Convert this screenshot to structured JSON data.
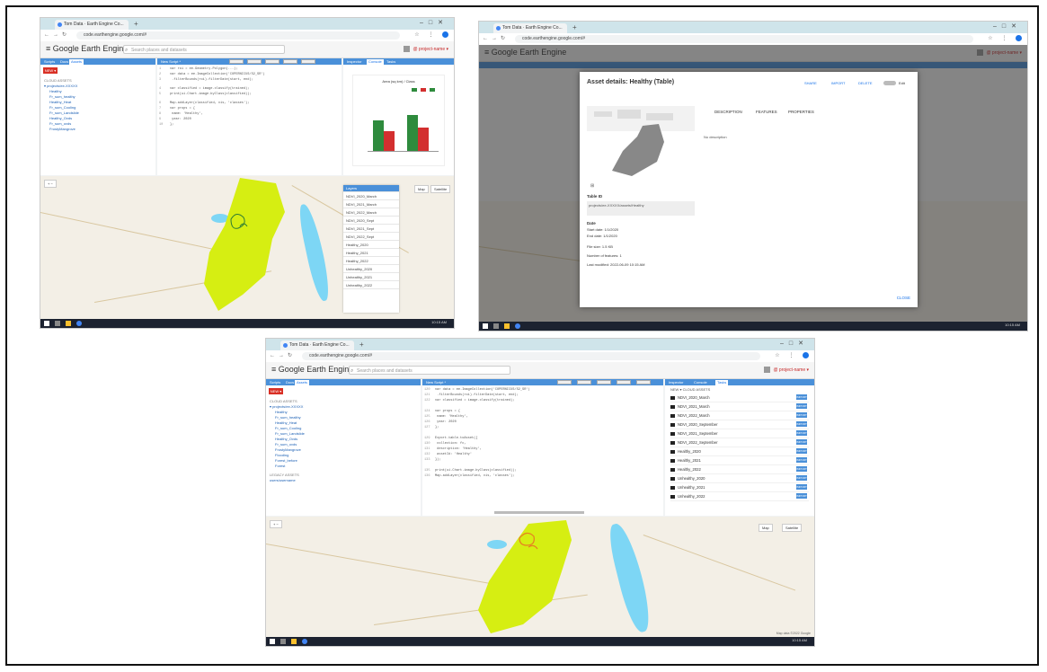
{
  "browser": {
    "tab_title": "Tom Data · Earth Engine Co...",
    "url": "code.earthengine.google.com/#"
  },
  "gee": {
    "logo": "≡ Google Earth Engine",
    "search_placeholder": "Search places and datasets",
    "user_label": "@ project-name ▾"
  },
  "panels": {
    "left_tabs": [
      "Scripts",
      "Docs",
      "Assets"
    ],
    "new_button": "NEW ▾",
    "tree_root": "CLOUD ASSETS",
    "tree_project": "▾ projects/ee-XXXXX",
    "tree_items": [
      "Healthy",
      "Fr_sum_healthy",
      "Healthy_Heat",
      "Fr_sum_Cooling",
      "Fr_sum_Landslide",
      "Healthy_Ovds",
      "Fr_sum_ovds",
      "FrostyMangrove",
      "Flooding",
      "Forest_before",
      "Forest"
    ],
    "legacy_label": "LEGACY ASSETS",
    "legacy_item": "users/username",
    "code_title": "New Script *",
    "code_buttons": [
      "Get Link",
      "Save",
      "Run",
      "Reset",
      "Apps"
    ],
    "right_tabs": [
      "Inspector",
      "Console",
      "Tasks"
    ],
    "chart_title": "Area (sq km) / Class"
  },
  "code_lines": [
    "var roi = ee.Geometry.Polygon(...);",
    "var data = ee.ImageCollection('COPERNICUS/S2_SR')",
    "  .filterBounds(roi).filterDate(start, end);",
    "var classified = image.classify(trained);",
    "print(ui.Chart.image.byClass(classified));",
    "Map.addLayer(classified, vis, 'classes');",
    "var props = {",
    "  name: 'Healthy',",
    "  year: 2020",
    "};",
    "Export.table.toAsset({",
    "  collection: fc,",
    "  description: 'Healthy',",
    "  assetId: 'Healthy'",
    "});"
  ],
  "layers": [
    "Layers",
    "NDVI_2020_March",
    "NDVI_2021_March",
    "NDVI_2022_March",
    "NDVI_2020_Sept",
    "NDVI_2021_Sept",
    "NDVI_2022_Sept",
    "Healthy_2020",
    "Healthy_2021",
    "Healthy_2022",
    "Unhealthy_2020",
    "Unhealthy_2021",
    "Unhealthy_2022"
  ],
  "map": {
    "map_label": "Map",
    "satellite_label": "Satellite",
    "zoom_controls": "+ −",
    "attribution": "Map data ©2022 Google"
  },
  "dialog": {
    "title": "Asset details: Healthy (Table)",
    "actions": [
      "SHARE",
      "IMPORT",
      "DELETE"
    ],
    "toggle_label": "Edit",
    "tabs": [
      "DESCRIPTION",
      "FEATURES",
      "PROPERTIES"
    ],
    "description_text": "No description",
    "table_id_label": "Table ID",
    "table_id_value": "projects/ee-XXXXX/assets/Healthy",
    "date_label": "Date",
    "start_date": "Start date: 1/1/2020",
    "end_date": "End date: 1/1/2020",
    "file_size": "File size: 1.5 KB",
    "num_features": "Number of features: 1",
    "last_modified": "Last modified: 2022-06-09 10:15 AM",
    "close_button": "CLOSE"
  },
  "assets_list": {
    "header": "NEW ▾  CLOUD ASSETS",
    "items": [
      "NDVI_2020_March",
      "NDVI_2021_March",
      "NDVI_2022_March",
      "NDVI_2020_September",
      "NDVI_2021_September",
      "NDVI_2022_September",
      "Healthy_2020",
      "Healthy_2021",
      "Healthy_2022",
      "Unhealthy_2020",
      "Unhealthy_2021",
      "Unhealthy_2022"
    ],
    "import_label": "IMPORT"
  },
  "taskbar": {
    "time": "10:15 AM"
  },
  "colors": {
    "roi_fill": "#d6ee12",
    "lake": "#7dd6f5",
    "accent": "#4a90d9",
    "new_button": "#d93025",
    "bar_green": "#2e8b3d",
    "bar_red": "#d32f2f"
  }
}
